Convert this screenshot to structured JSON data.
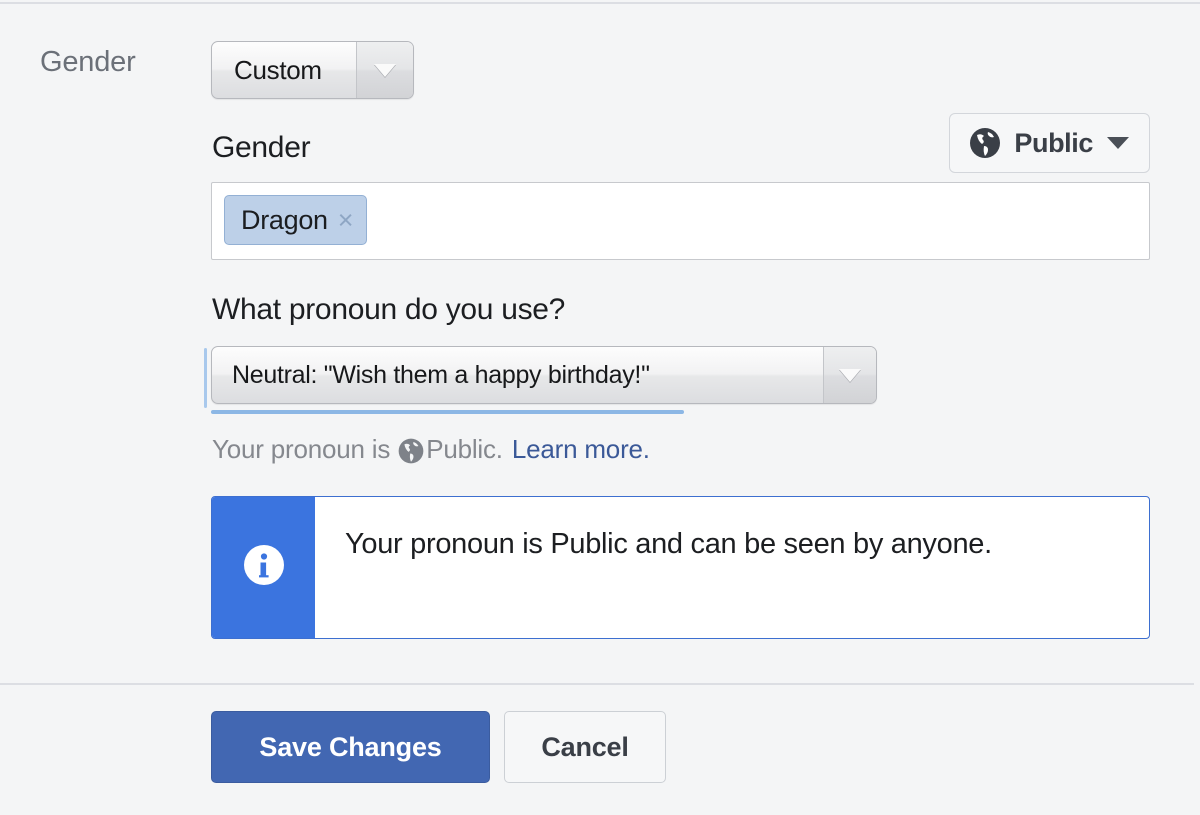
{
  "row": {
    "label": "Gender",
    "gender_select": {
      "value": "Custom",
      "arrow_icon": "chevron-down-icon"
    }
  },
  "panel": {
    "gender_field_label": "Gender",
    "audience": {
      "label": "Public",
      "globe_icon": "globe-icon",
      "caret_icon": "caret-down-icon"
    },
    "tokens": [
      {
        "label": "Dragon",
        "remove_icon": "close-icon",
        "remove_glyph": "×"
      }
    ],
    "pronoun_question": "What pronoun do you use?",
    "pronoun_select": {
      "value": "Neutral: \"Wish them a happy birthday!\"",
      "arrow_icon": "chevron-down-icon"
    },
    "helper": {
      "prefix": "Your pronoun is",
      "globe_icon": "globe-icon",
      "audience": "Public.",
      "link": "Learn more."
    },
    "info_banner": {
      "icon": "info-circle-icon",
      "icon_glyph": "i",
      "message": "Your pronoun is Public and can be seen by anyone."
    }
  },
  "footer": {
    "save_label": "Save Changes",
    "cancel_label": "Cancel"
  },
  "colors": {
    "page_background": "#f4f5f6",
    "primary_button": "#4267b2",
    "link": "#3b5998",
    "info_accent": "#3b74df",
    "token_background": "#bdd0e8",
    "focus_underline": "#8cb7e5",
    "muted_text": "#85888e"
  }
}
